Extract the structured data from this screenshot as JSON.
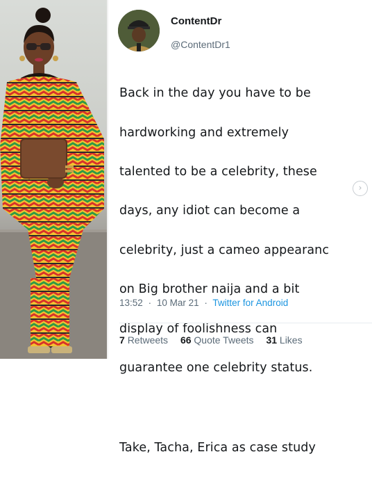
{
  "author": {
    "display_name": "ContentDr",
    "handle": "@ContentDr1"
  },
  "tweet": {
    "paragraphs": [
      "Back in the day you have to be",
      "hardworking and extremely",
      "talented to be a celebrity, these",
      "days, any idiot can become a",
      "celebrity, just a cameo appearanc",
      "on Big brother naija and a bit",
      "display of foolishness can",
      "guarantee one celebrity status."
    ],
    "closing": "Take, Tacha, Erica as case study"
  },
  "meta": {
    "time": "13:52",
    "sep": "·",
    "date": "10 Mar 21",
    "source": "Twitter for Android"
  },
  "stats": {
    "retweets_count": "7",
    "retweets_label": "Retweets",
    "quotes_count": "66",
    "quotes_label": "Quote Tweets",
    "likes_count": "31",
    "likes_label": "Likes"
  },
  "icons": {
    "next": "chevron-right-icon"
  },
  "colors": {
    "link": "#1b95e0",
    "text": "#14171a",
    "muted": "#5b6b78",
    "kente_red": "#d8322a",
    "kente_yellow": "#f2c230",
    "kente_green": "#2f9a45"
  }
}
